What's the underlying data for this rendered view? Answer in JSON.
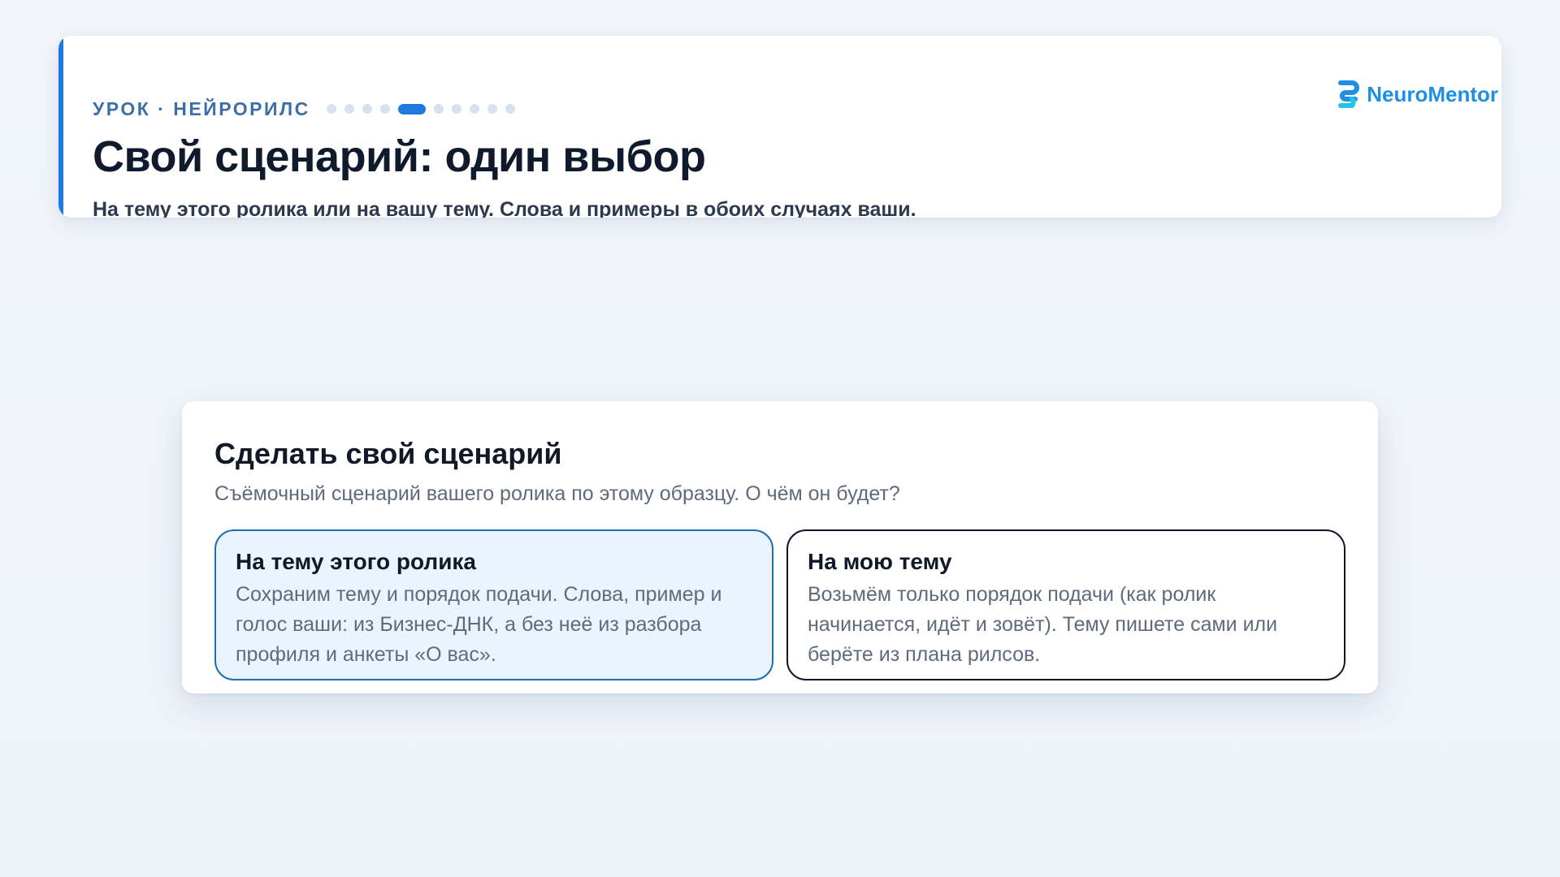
{
  "header": {
    "lesson_label": "УРОК · НЕЙРОРИЛС",
    "progress": {
      "total_steps": 11,
      "current_step": 5
    },
    "title": "Свой сценарий: один выбор",
    "subtitle": "На тему этого ролика или на вашу тему. Слова и примеры в обоих случаях ваши."
  },
  "brand": {
    "name": "NeuroMentor",
    "logo_icon": "neuromentor-logo-icon",
    "color": "#1f8fe6"
  },
  "accent_color": "#1f7ae0",
  "choice": {
    "title": "Сделать свой сценарий",
    "description": "Съёмочный сценарий вашего ролика по этому образцу. О чём он будет?",
    "options": [
      {
        "title": "На тему этого ролика",
        "text": "Сохраним тему и порядок подачи. Слова, пример и голос ваши: из Бизнес-ДНК, а без неё из разбора профиля и анкеты «О вас».",
        "selected": true
      },
      {
        "title": "На мою тему",
        "text": "Возьмём только порядок подачи (как ролик начинается, идёт и зовёт). Тему пишете сами или берёте из плана рилсов.",
        "selected": false
      }
    ]
  }
}
